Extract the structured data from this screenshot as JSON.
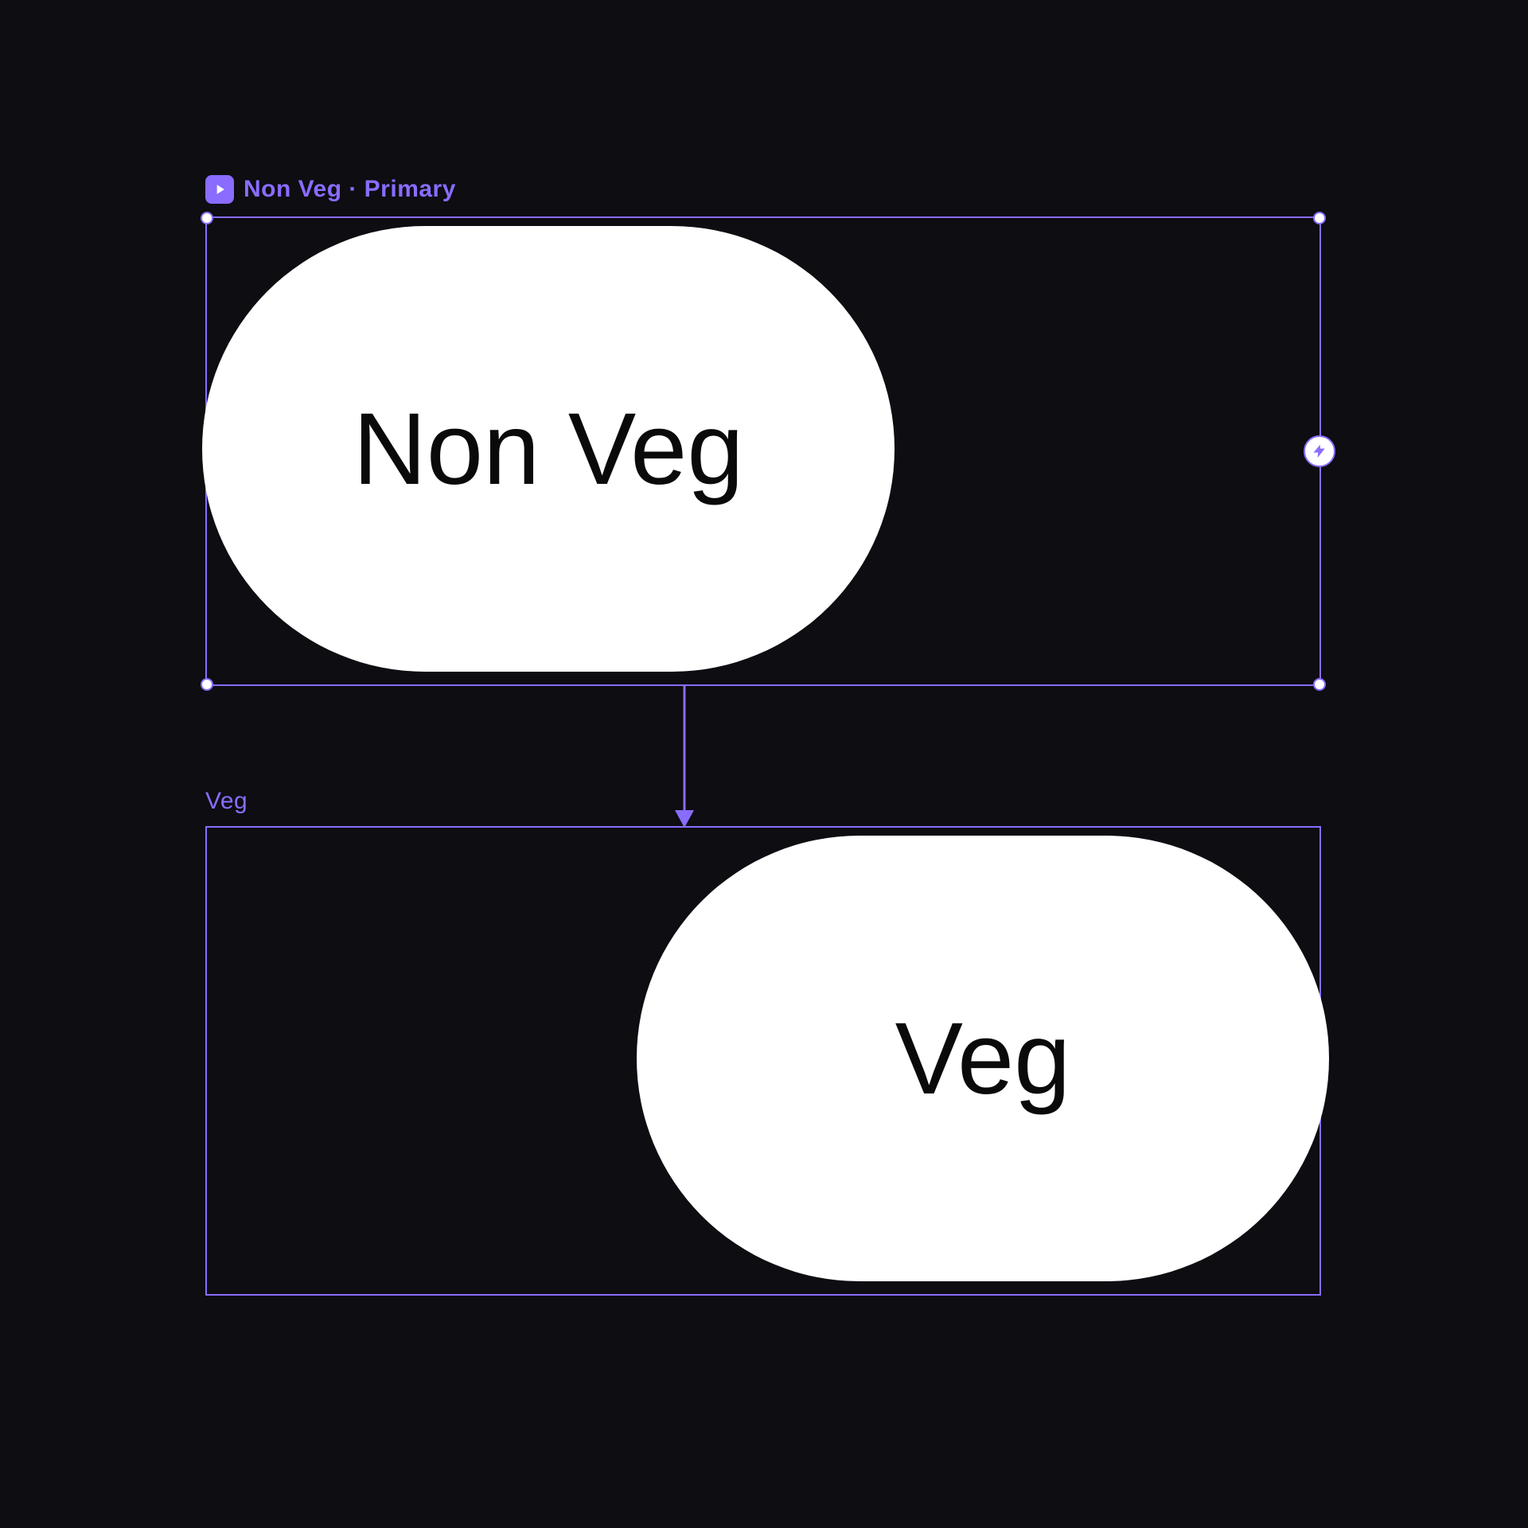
{
  "colors": {
    "background": "#0d0d12",
    "accent": "#8a6cff",
    "pill_fill": "#ffffff",
    "pill_text": "#0a0a0a"
  },
  "frames": {
    "top": {
      "label": "Non Veg · Primary",
      "selected": true,
      "content_text": "Non Veg"
    },
    "bottom": {
      "label": "Veg",
      "selected": false,
      "content_text": "Veg"
    }
  },
  "connector": {
    "from_frame": "top",
    "to_frame": "bottom",
    "direction": "down"
  }
}
